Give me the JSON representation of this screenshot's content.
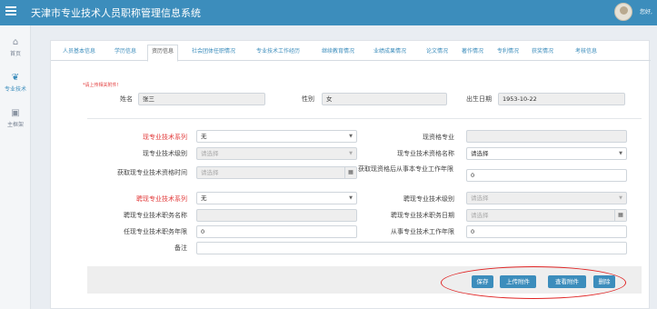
{
  "app": {
    "title": "天津市专业技术人员职称管理信息系统",
    "greeting": "您好,"
  },
  "sidebar": {
    "items": [
      {
        "label": "首页",
        "icon": "home-icon"
      },
      {
        "label": "专业技术",
        "icon": "leaf-icon"
      },
      {
        "label": "主框架",
        "icon": "image-icon"
      }
    ]
  },
  "tabs": [
    "人员基本信息",
    "学历信息",
    "资历信息",
    "社会团体任职情况",
    "专业技术工作经历",
    "继续教育情况",
    "业绩成果情况",
    "论文情况",
    "著作情况",
    "专利情况",
    "获奖情况",
    "考核信息"
  ],
  "form": {
    "required_note": "*请上传相关附件!",
    "name_label": "姓名",
    "name_value": "张三",
    "gender_label": "性别",
    "gender_value": "女",
    "birth_label": "出生日期",
    "birth_value": "1953-10-22",
    "cur_series_label": "现专业技术系列",
    "cur_series_value": "无",
    "cur_major_label": "现资格专业",
    "cur_major_value": "",
    "cur_level_label": "现专业技术级别",
    "cur_level_value": "请选择",
    "cur_qual_name_label": "现专业技术资格名称",
    "cur_qual_name_value": "请选择",
    "obtain_time_label": "获取现专业技术资格时间",
    "obtain_time_value": "请选择",
    "years_after_label": "获取现资格后从事本专业工作年限",
    "years_after_value": "0",
    "hire_series_label": "聘现专业技术系列",
    "hire_series_value": "无",
    "hire_level_label": "聘现专业技术级别",
    "hire_level_value": "请选择",
    "hire_post_name_label": "聘现专业技术职务名称",
    "hire_post_name_value": "",
    "hire_post_date_label": "聘现专业技术职务日期",
    "hire_post_date_value": "请选择",
    "post_years_label": "任现专业技术职务年限",
    "post_years_value": "0",
    "work_years_label": "从事专业技术工作年限",
    "work_years_value": "0",
    "remark_label": "备注",
    "remark_value": ""
  },
  "buttons": {
    "save": "保存",
    "upload": "上传附件",
    "view": "查看附件",
    "delete": "删除"
  },
  "colors": {
    "primary": "#3c8dbc",
    "required": "#e23b3b",
    "highlight": "#e02424"
  }
}
